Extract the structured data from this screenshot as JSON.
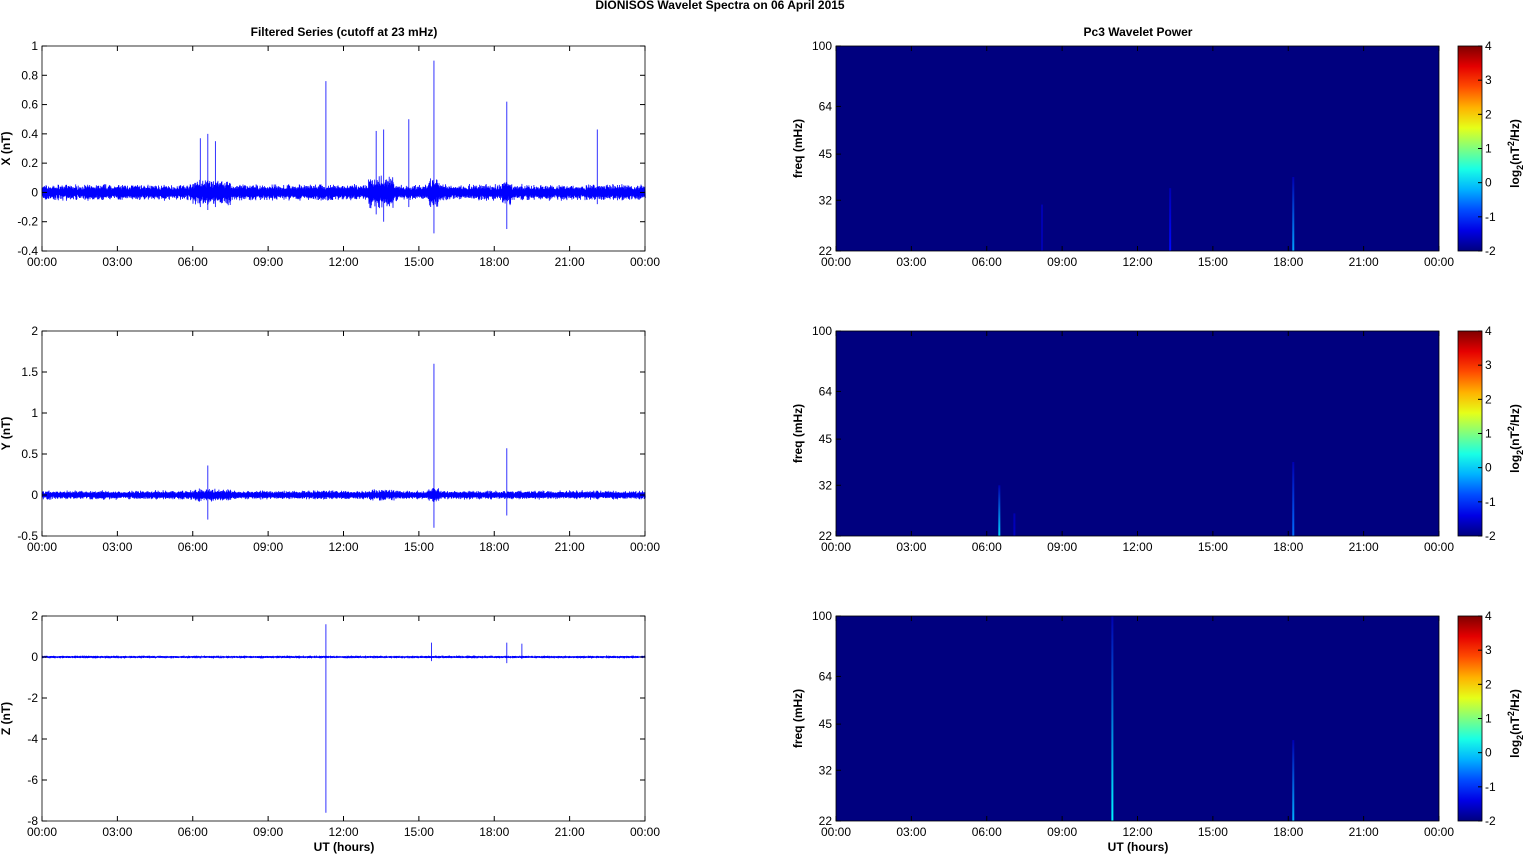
{
  "title": "DIONISOS Wavelet Spectra on 06 April     2015",
  "left_title": "Filtered Series (cutoff at 23 mHz)",
  "right_title": "Pc3 Wavelet Power",
  "xlabel": "UT (hours)",
  "colorbar_label": "log2(nT2/Hz)",
  "chart_data": [
    {
      "type": "line",
      "component": "X",
      "ylabel": "X (nT)",
      "ylim": [
        -0.4,
        1
      ],
      "yticks": [
        -0.4,
        -0.2,
        0,
        0.2,
        0.4,
        0.6,
        0.8,
        1
      ],
      "noise": 0.05,
      "bursts": [
        [
          6,
          7.5,
          1.6
        ],
        [
          13,
          14,
          2
        ],
        [
          15.4,
          15.8,
          1.8
        ],
        [
          18.3,
          18.7,
          1.6
        ]
      ],
      "spikes": [
        [
          6.3,
          0.37,
          -0.1
        ],
        [
          6.6,
          0.4,
          -0.12
        ],
        [
          6.9,
          0.35,
          -0.1
        ],
        [
          11.3,
          0.76,
          -0.05
        ],
        [
          13.3,
          0.42,
          -0.15
        ],
        [
          13.6,
          0.43,
          -0.2
        ],
        [
          14.6,
          0.5,
          -0.1
        ],
        [
          15.6,
          0.9,
          -0.28
        ],
        [
          18.5,
          0.62,
          -0.25
        ],
        [
          22.1,
          0.43,
          -0.08
        ]
      ]
    },
    {
      "type": "line",
      "component": "Y",
      "ylabel": "Y (nT)",
      "ylim": [
        -0.5,
        2
      ],
      "yticks": [
        -0.5,
        0,
        0.5,
        1,
        1.5,
        2
      ],
      "noise": 0.05,
      "bursts": [
        [
          6,
          7.5,
          1.4
        ],
        [
          13,
          14,
          1.3
        ],
        [
          15.4,
          15.8,
          1.6
        ]
      ],
      "spikes": [
        [
          6.6,
          0.36,
          -0.3
        ],
        [
          15.6,
          1.6,
          -0.4
        ],
        [
          18.5,
          0.57,
          -0.25
        ]
      ]
    },
    {
      "type": "line",
      "component": "Z",
      "ylabel": "Z (nT)",
      "ylim": [
        -8,
        2
      ],
      "yticks": [
        -8,
        -6,
        -4,
        -2,
        0,
        2
      ],
      "noise": 0.05,
      "bursts": [],
      "spikes": [
        [
          11.3,
          1.6,
          -7.6
        ],
        [
          15.5,
          0.7,
          -0.2
        ],
        [
          18.5,
          0.7,
          -0.3
        ],
        [
          19.1,
          0.65,
          -0.1
        ]
      ]
    },
    {
      "type": "heatmap",
      "component": "X",
      "ylabel": "freq (mHz)",
      "yticks": [
        22,
        32,
        45,
        64,
        100
      ],
      "ylim": [
        22,
        100
      ],
      "clim": [
        -2,
        4
      ],
      "cticks": [
        -2,
        -1,
        0,
        1,
        2,
        3,
        4
      ],
      "background": -2,
      "streaks": [
        [
          8.2,
          31,
          -1.7
        ],
        [
          13.3,
          35,
          -1.2
        ],
        [
          18.2,
          38,
          -0.3
        ]
      ]
    },
    {
      "type": "heatmap",
      "component": "Y",
      "ylabel": "freq (mHz)",
      "yticks": [
        22,
        32,
        45,
        64,
        100
      ],
      "ylim": [
        22,
        100
      ],
      "clim": [
        -2,
        4
      ],
      "cticks": [
        -2,
        -1,
        0,
        1,
        2,
        3,
        4
      ],
      "background": -2,
      "streaks": [
        [
          6.5,
          32,
          0
        ],
        [
          7.1,
          26,
          -1.6
        ],
        [
          18.2,
          38,
          -0.6
        ]
      ]
    },
    {
      "type": "heatmap",
      "component": "Z",
      "ylabel": "freq (mHz)",
      "yticks": [
        22,
        32,
        45,
        64,
        100
      ],
      "ylim": [
        22,
        100
      ],
      "clim": [
        -2,
        4
      ],
      "cticks": [
        -2,
        -1,
        0,
        1,
        2,
        3,
        4
      ],
      "background": -2,
      "streaks": [
        [
          11,
          100,
          0.2
        ],
        [
          18.2,
          40,
          -0.2
        ]
      ]
    }
  ],
  "xticks": [
    "00:00",
    "03:00",
    "06:00",
    "09:00",
    "12:00",
    "15:00",
    "18:00",
    "21:00",
    "00:00"
  ]
}
